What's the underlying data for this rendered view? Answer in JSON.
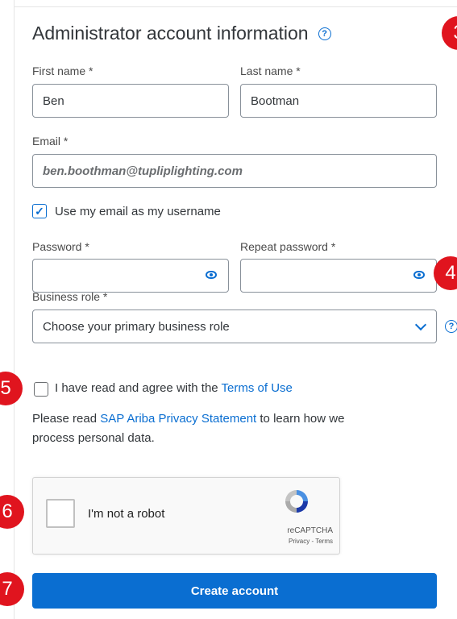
{
  "form": {
    "title": "Administrator account information",
    "first_name_label": "First name *",
    "first_name_value": "Ben",
    "last_name_label": "Last name *",
    "last_name_value": "Bootman",
    "email_label": "Email *",
    "email_value": "ben.boothman@tupliplighting.com",
    "use_email_checkbox_checked": true,
    "use_email_label": "Use my email as my username",
    "password_label": "Password *",
    "repeat_password_label": "Repeat password *",
    "business_role_label": "Business role *",
    "business_role_value": "Choose your primary business role",
    "terms_text": "I have read and agree with the ",
    "terms_link": "Terms of Use",
    "privacy_text_1": "Please read ",
    "privacy_link": "SAP Ariba Privacy Statement",
    "privacy_text_2": " to learn how we",
    "privacy_text_3": "process personal data.",
    "create_button": "Create account"
  },
  "recaptcha": {
    "label": "I'm not a robot",
    "brand": "reCAPTCHA",
    "terms": "Privacy - Terms"
  },
  "badges": [
    "3",
    "4",
    "5",
    "6",
    "7"
  ],
  "colors": {
    "accent": "#0a6ed1",
    "badge": "#e0141e"
  }
}
